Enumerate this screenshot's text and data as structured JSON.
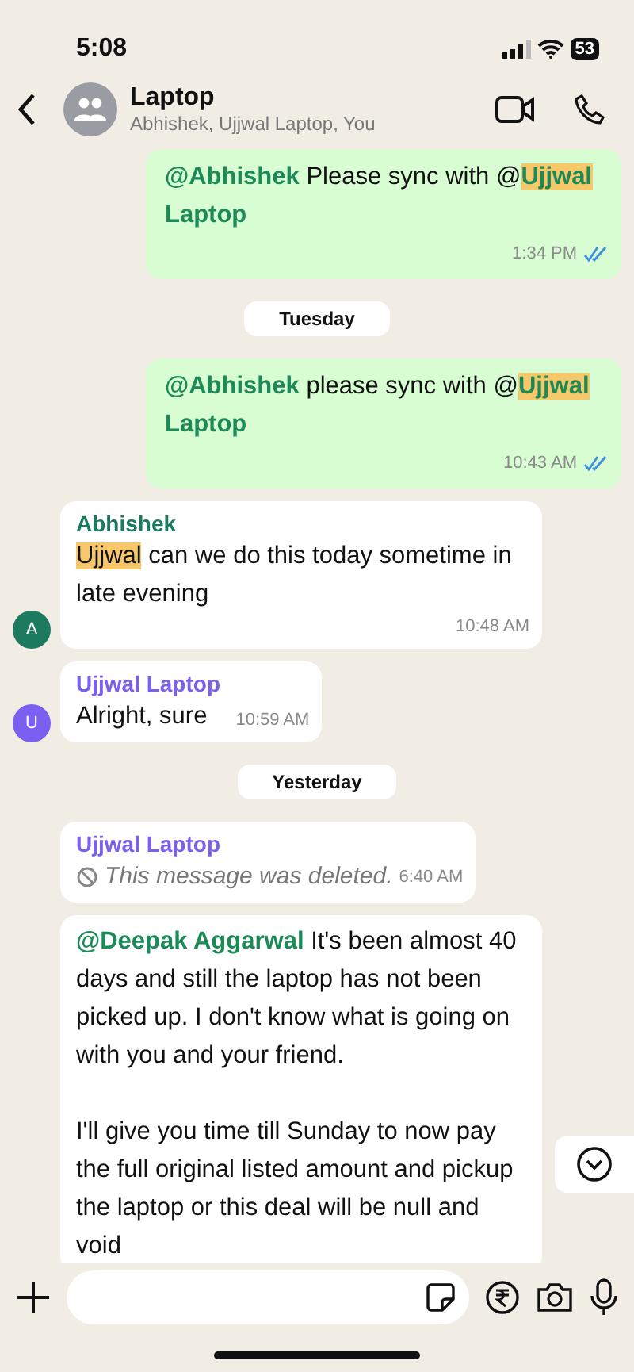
{
  "status_bar": {
    "time": "5:08",
    "battery": "53"
  },
  "header": {
    "title": "Laptop",
    "subtitle": "Abhishek, Ujjwal Laptop, You"
  },
  "messages": [
    {
      "kind": "outgoing",
      "segments": [
        {
          "text": "@Abhishek",
          "kind": "mention"
        },
        {
          "text": " Please sync with "
        },
        {
          "text": "@"
        },
        {
          "text": "Ujjwal",
          "kind": "mention",
          "highlighted": true
        },
        {
          "text": " Laptop",
          "kind": "mention"
        }
      ],
      "time": "1:34 PM",
      "read": true
    },
    {
      "kind": "date",
      "text": "Tuesday"
    },
    {
      "kind": "outgoing",
      "segments": [
        {
          "text": "@Abhishek",
          "kind": "mention"
        },
        {
          "text": " please sync with "
        },
        {
          "text": "@"
        },
        {
          "text": "Ujjwal",
          "kind": "mention",
          "highlighted": true
        },
        {
          "text": " Laptop",
          "kind": "mention"
        }
      ],
      "time": "10:43 AM",
      "read": true
    },
    {
      "kind": "incoming",
      "sender": "Abhishek",
      "color": "#1c7a5e",
      "avatar": "A",
      "segments": [
        {
          "text": "Ujjwal",
          "highlighted": true
        },
        {
          "text": " can we do this today sometime in late evening"
        }
      ],
      "time": "10:48 AM"
    },
    {
      "kind": "incoming",
      "sender": "Ujjwal Laptop",
      "color": "#7b5ff0",
      "avatar": "U",
      "segments": [
        {
          "text": "Alright, sure"
        }
      ],
      "time": "10:59 AM"
    },
    {
      "kind": "date",
      "text": "Yesterday"
    },
    {
      "kind": "deleted",
      "sender": "Ujjwal Laptop",
      "color": "#7b5ff0",
      "text": "This message was deleted.",
      "time": "6:40 AM"
    },
    {
      "kind": "incoming",
      "segments": [
        {
          "text": "@Deepak Aggarwal",
          "kind": "mention"
        },
        {
          "text": " It's been almost 40 days and still the laptop has not been picked up. I don't know what is going on with you and your friend.\n\nI'll give you time till Sunday to now pay the full original listed amount and pickup the laptop or this deal will be null and void"
        }
      ]
    }
  ]
}
